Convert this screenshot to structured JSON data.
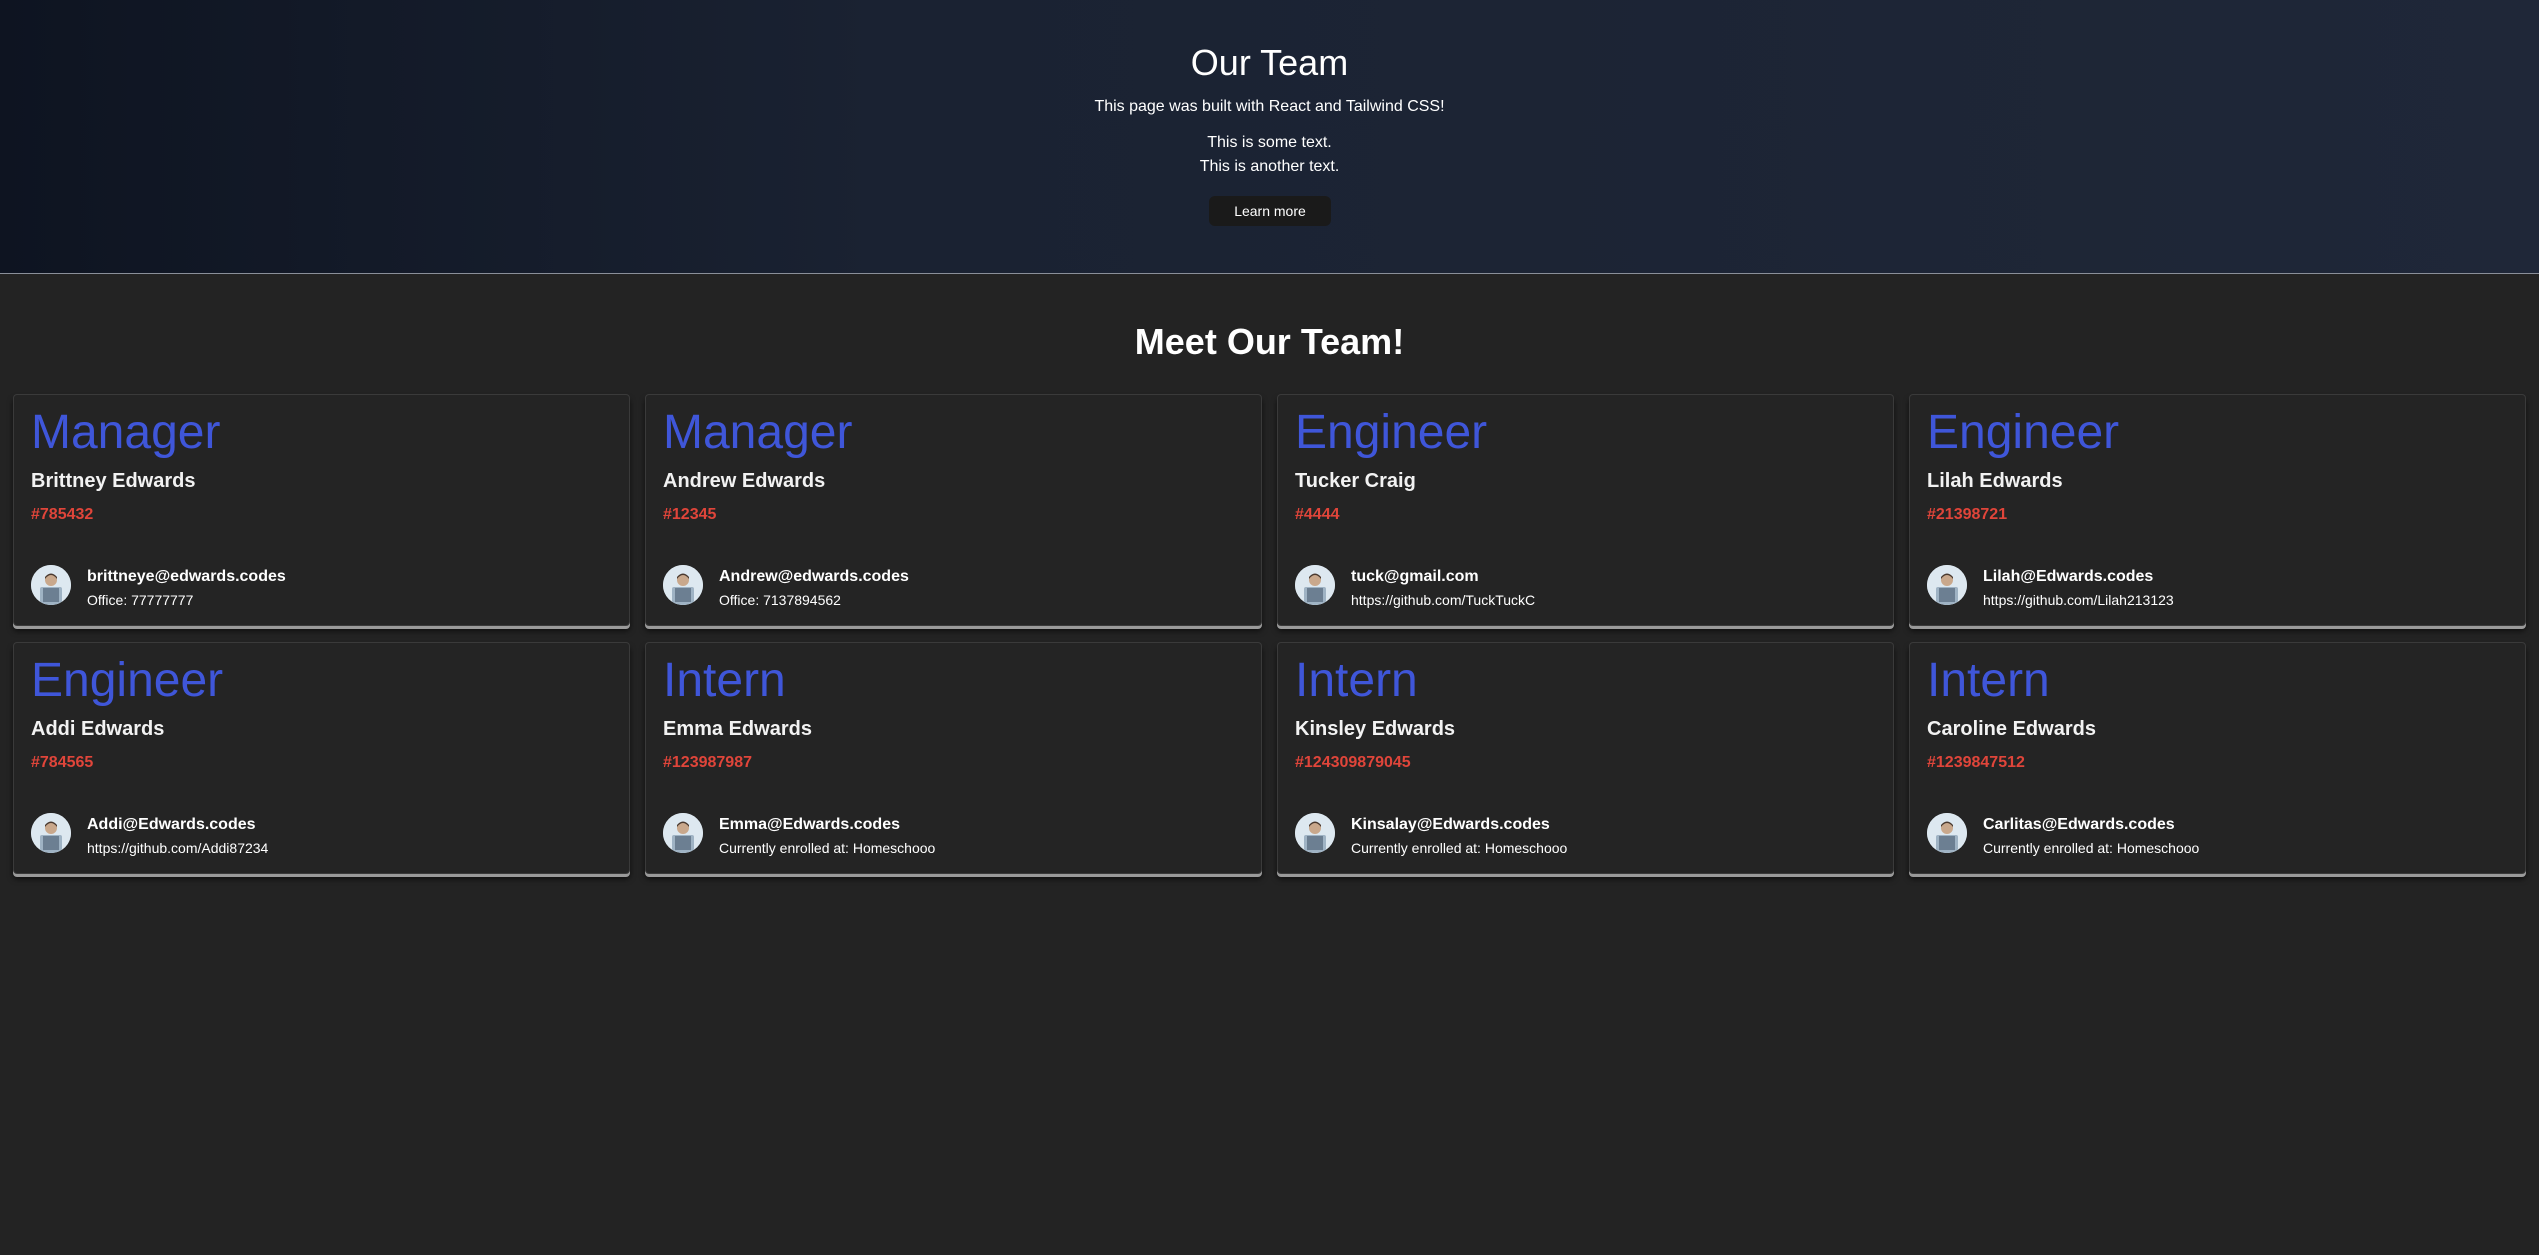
{
  "hero": {
    "title": "Our Team",
    "subtitle": "This page was built with React and Tailwind CSS!",
    "line1": "This is some text.",
    "line2": "This is another text.",
    "button_label": "Learn more"
  },
  "team": {
    "title": "Meet Our Team!",
    "members": [
      {
        "role": "Manager",
        "name": "Brittney Edwards",
        "id": "#785432",
        "email": "brittneye@edwards.codes",
        "detail": "Office: 77777777"
      },
      {
        "role": "Manager",
        "name": "Andrew Edwards",
        "id": "#12345",
        "email": "Andrew@edwards.codes",
        "detail": "Office: 7137894562"
      },
      {
        "role": "Engineer",
        "name": "Tucker Craig",
        "id": "#4444",
        "email": "tuck@gmail.com",
        "detail": "https://github.com/TuckTuckC"
      },
      {
        "role": "Engineer",
        "name": "Lilah Edwards",
        "id": "#21398721",
        "email": "Lilah@Edwards.codes",
        "detail": "https://github.com/Lilah213123"
      },
      {
        "role": "Engineer",
        "name": "Addi Edwards",
        "id": "#784565",
        "email": "Addi@Edwards.codes",
        "detail": "https://github.com/Addi87234"
      },
      {
        "role": "Intern",
        "name": "Emma Edwards",
        "id": "#123987987",
        "email": "Emma@Edwards.codes",
        "detail": "Currently enrolled at: Homeschooo"
      },
      {
        "role": "Intern",
        "name": "Kinsley Edwards",
        "id": "#124309879045",
        "email": "Kinsalay@Edwards.codes",
        "detail": "Currently enrolled at: Homeschooo"
      },
      {
        "role": "Intern",
        "name": "Caroline Edwards",
        "id": "#1239847512",
        "email": "Carlitas@Edwards.codes",
        "detail": "Currently enrolled at: Homeschooo"
      }
    ]
  },
  "colors": {
    "role": "#3f56d9",
    "id": "#e0453a",
    "background": "#232323",
    "hero_start": "#0e1421",
    "hero_end": "#1f2738"
  },
  "icons": {
    "avatar": "user-avatar-icon"
  }
}
